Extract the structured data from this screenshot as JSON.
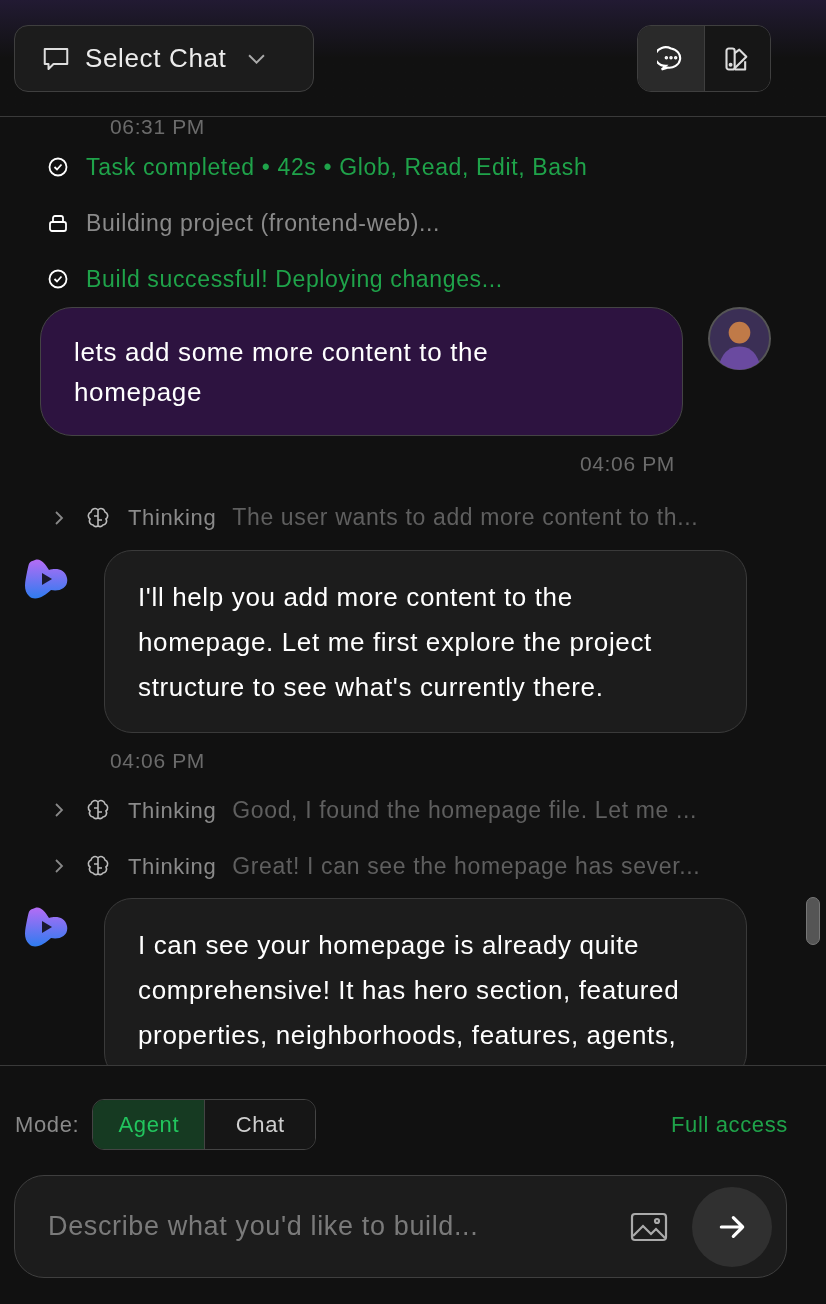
{
  "header": {
    "chat_select": {
      "label": "Select Chat"
    },
    "view_toggle": [
      {
        "kind": "chat",
        "selected": true
      },
      {
        "kind": "panel",
        "selected": false
      }
    ]
  },
  "messages": [
    {
      "kind": "timestamp",
      "text": "06:31 PM"
    },
    {
      "kind": "status_done",
      "text": "Task completed • 42s • Glob, Read, Edit, Bash"
    },
    {
      "kind": "status_running",
      "text": "Building project (frontend-web)..."
    },
    {
      "kind": "status_done",
      "text": "Build successful! Deploying changes..."
    },
    {
      "kind": "user",
      "text": "lets add some more content to the homepage",
      "time": "04:06 PM"
    },
    {
      "kind": "thinking",
      "label": "Thinking",
      "text": "The user wants to add more content to th..."
    },
    {
      "kind": "assistant",
      "text": "I'll help you add more content to the homepage. Let me first explore the project structure to see what's currently there.",
      "time": "04:06 PM"
    },
    {
      "kind": "thinking",
      "label": "Thinking",
      "text": "Good, I found the homepage file. Let me ..."
    },
    {
      "kind": "thinking",
      "label": "Thinking",
      "text": "Great! I can see the homepage has sever..."
    },
    {
      "kind": "assistant",
      "text": "I can see your homepage is already quite comprehensive! It has hero section, featured properties, neighborhoods, features, agents,"
    }
  ],
  "composer": {
    "mode_label": "Mode:",
    "modes": [
      {
        "label": "Agent",
        "selected": true
      },
      {
        "label": "Chat",
        "selected": false
      }
    ],
    "access": "Full access",
    "placeholder": "Describe what you'd like to build..."
  }
}
